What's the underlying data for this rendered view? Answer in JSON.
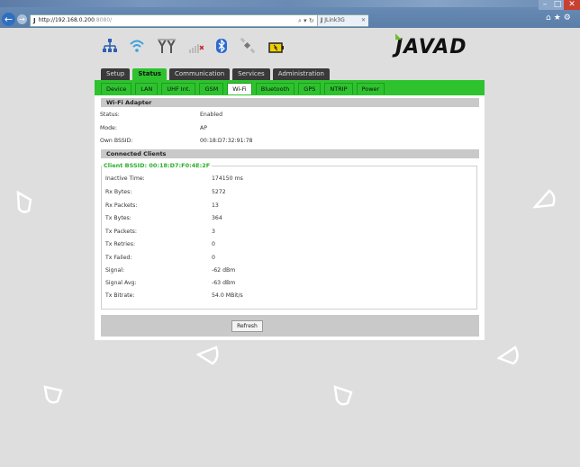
{
  "browser": {
    "url_host": "http://192.168.0.200",
    "url_port": ":8080/",
    "tab_title": "JLink3G",
    "address_controls": "⌕ ▾ ↻"
  },
  "header": {
    "logo_text": "JAVAD",
    "status_icons": [
      "network-icon",
      "wifi-icon",
      "antenna-icon",
      "signal-icon",
      "bluetooth-icon",
      "satellite-icon",
      "battery-icon"
    ]
  },
  "main_tabs": [
    {
      "label": "Setup",
      "active": false
    },
    {
      "label": "Status",
      "active": true
    },
    {
      "label": "Communication",
      "active": false
    },
    {
      "label": "Services",
      "active": false
    },
    {
      "label": "Administration",
      "active": false
    }
  ],
  "sub_tabs": [
    {
      "label": "Device",
      "active": false
    },
    {
      "label": "LAN",
      "active": false
    },
    {
      "label": "UHF Int.",
      "active": false
    },
    {
      "label": "GSM",
      "active": false
    },
    {
      "label": "Wi-Fi",
      "active": true
    },
    {
      "label": "Bluetooth",
      "active": false
    },
    {
      "label": "GPS",
      "active": false
    },
    {
      "label": "NTRIP",
      "active": false
    },
    {
      "label": "Power",
      "active": false
    }
  ],
  "wifi_adapter": {
    "title": "Wi-Fi Adapter",
    "rows": [
      {
        "label": "Status:",
        "value": "Enabled"
      },
      {
        "label": "Mode:",
        "value": "AP"
      },
      {
        "label": "Own BSSID:",
        "value": "00:18:D7:32:91:78"
      }
    ]
  },
  "connected_clients": {
    "title": "Connected Clients",
    "client_bssid": "Client BSSID: 00:18:D7:F0:4E:2F",
    "rows": [
      {
        "label": "Inactive Time:",
        "value": "174150 ms"
      },
      {
        "label": "Rx Bytes:",
        "value": "5272"
      },
      {
        "label": "Rx Packets:",
        "value": "13"
      },
      {
        "label": "Tx Bytes:",
        "value": "364"
      },
      {
        "label": "Tx Packets:",
        "value": "3"
      },
      {
        "label": "Tx Retries:",
        "value": "0"
      },
      {
        "label": "Tx Failed:",
        "value": "0"
      },
      {
        "label": "Signal:",
        "value": "-62 dBm"
      },
      {
        "label": "Signal Avg:",
        "value": "-63 dBm"
      },
      {
        "label": "Tx Bitrate:",
        "value": "54.0 MBit/s"
      }
    ]
  },
  "actions": {
    "refresh_label": "Refresh"
  },
  "colors": {
    "accent_green": "#2ec32e",
    "section_gray": "#c9c9c9",
    "page_bg": "#dedede"
  }
}
